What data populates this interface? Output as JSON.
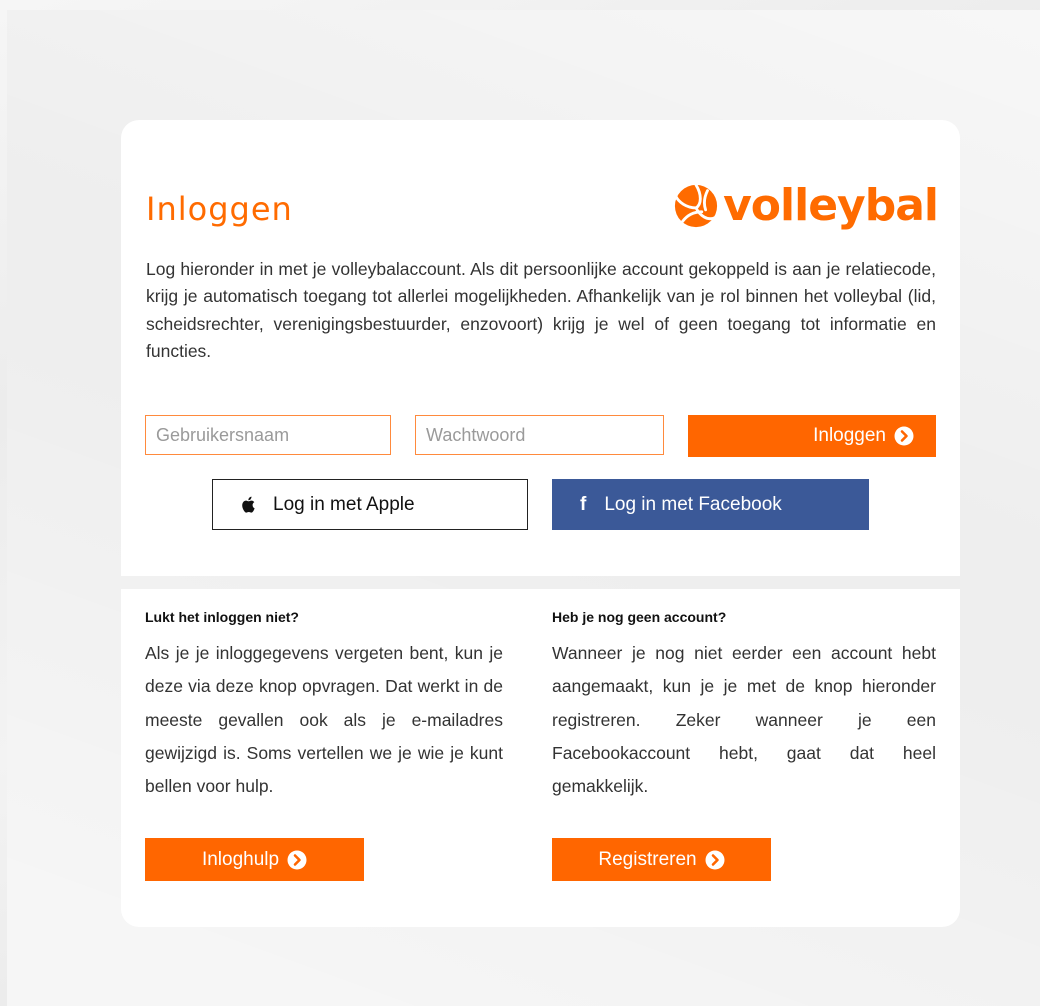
{
  "login": {
    "title": "Inloggen",
    "logo_text": "volleybal",
    "intro": "Log hieronder in met je volleybalaccount. Als dit persoonlijke account gekoppeld is aan je relatiecode, krijg je automatisch toegang tot allerlei mogelijkheden. Afhankelijk van je rol binnen het volleybal (lid, scheidsrechter, verenigingsbestuurder, enzovoort) krijg je wel of geen toegang tot informatie en functies.",
    "username_placeholder": "Gebruikersnaam",
    "username_value": "",
    "password_placeholder": "Wachtwoord",
    "password_value": "",
    "login_button": "Inloggen",
    "apple_button": "Log in met Apple",
    "facebook_button": "Log in met Facebook"
  },
  "help": {
    "heading": "Lukt het inloggen niet?",
    "text": "Als je je inloggegevens vergeten bent, kun je deze via deze knop opvragen. Dat werkt in de meeste gevallen ook als je e-mailadres gewijzigd is. Soms vertellen we je wie je kunt bellen voor hulp.",
    "button": "Inloghulp"
  },
  "register": {
    "heading": "Heb je nog geen account?",
    "text": "Wanneer je nog niet eerder een account hebt aangemaakt, kun je je met de knop hieronder registreren. Zeker wanneer je een Facebookaccount hebt, gaat dat heel gemakkelijk.",
    "button": "Registreren"
  },
  "icons": {
    "logo": "volleyball-icon",
    "chevron": "chevron-circle-right-icon",
    "apple": "apple-icon",
    "facebook": "facebook-icon"
  },
  "colors": {
    "accent": "#ff6600",
    "facebook": "#3b5998"
  }
}
